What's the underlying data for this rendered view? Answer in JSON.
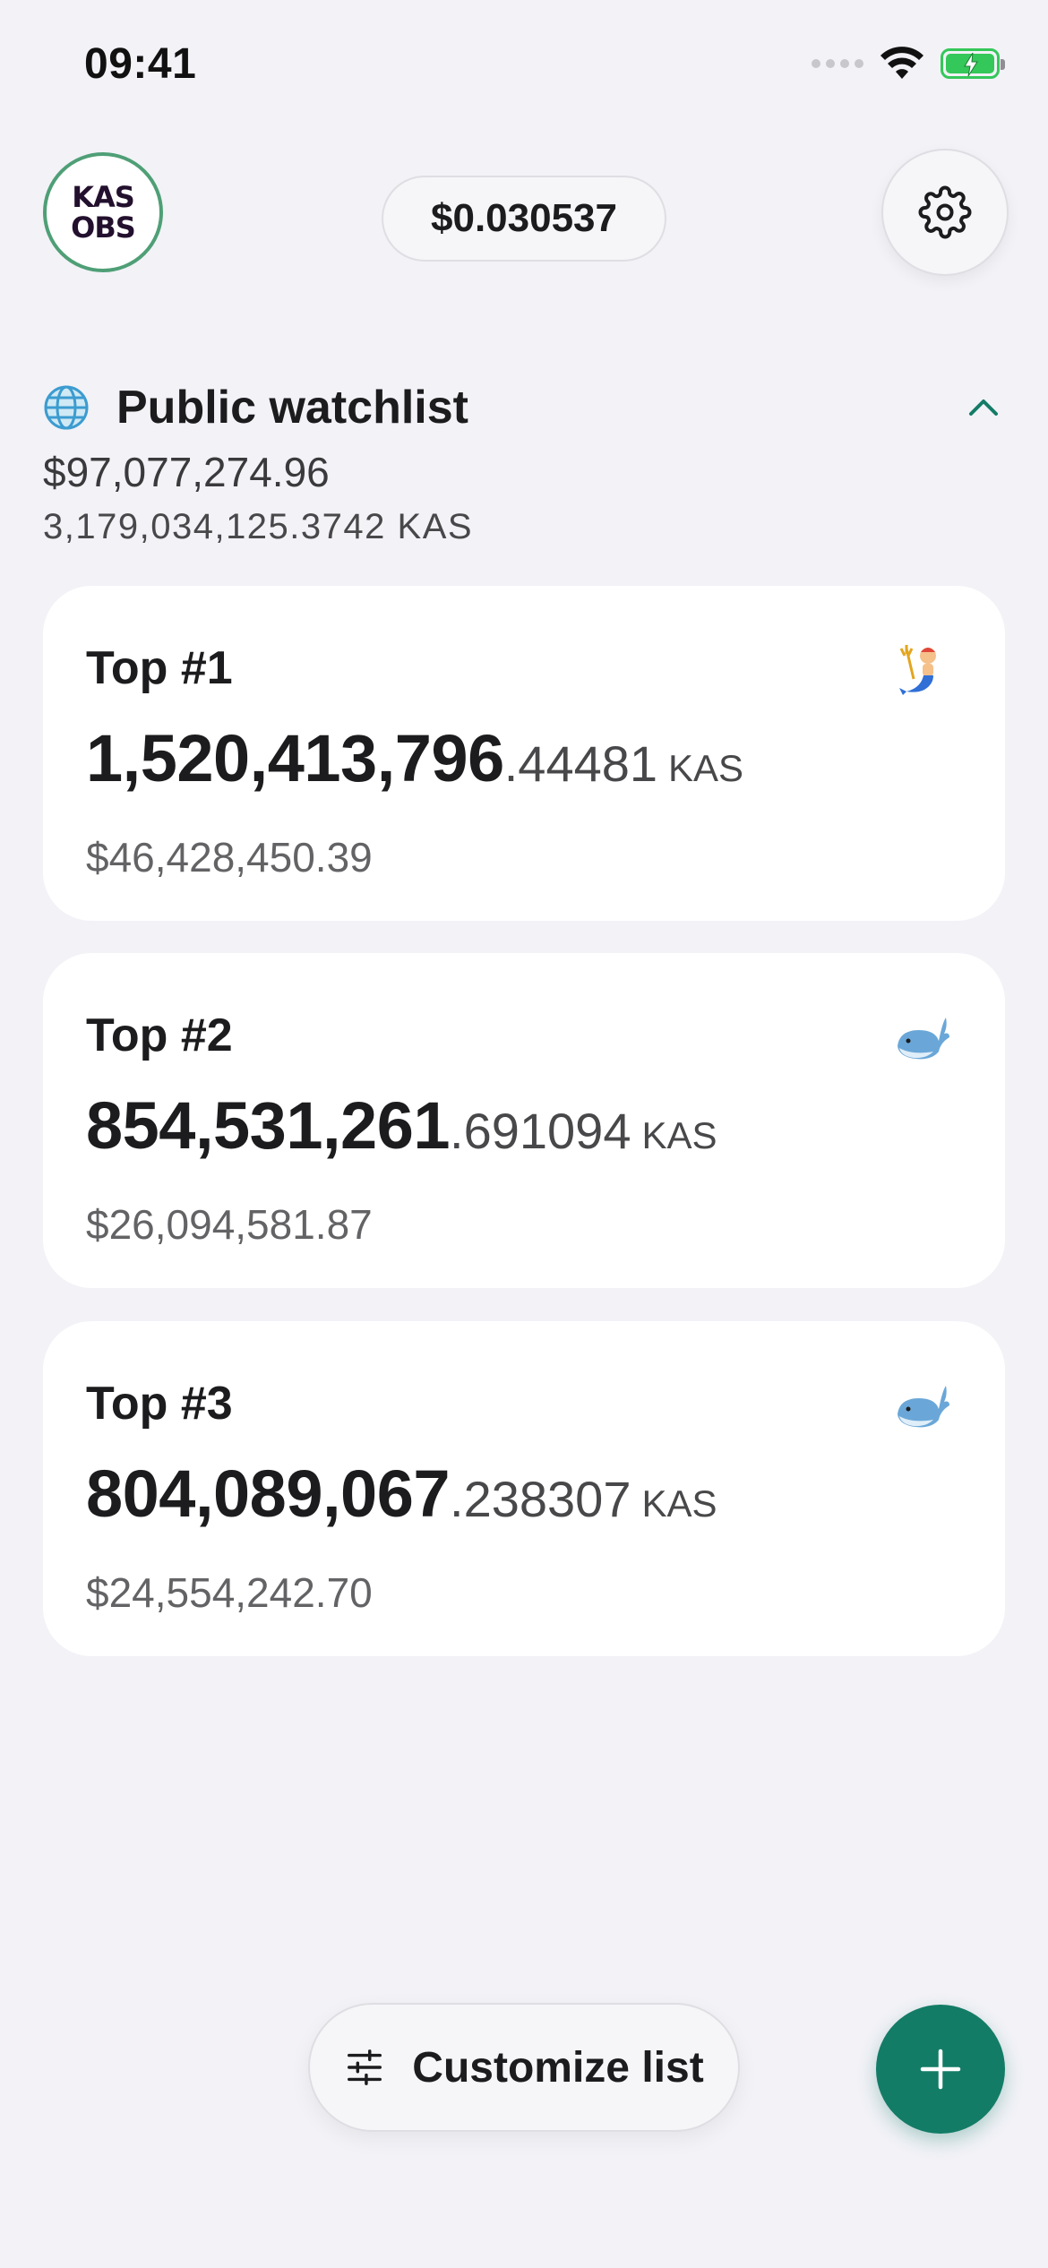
{
  "status_bar": {
    "time": "09:41",
    "icons": [
      "cellular-signal-icon",
      "wifi-icon",
      "battery-charging-icon"
    ],
    "battery_color": "#34c759"
  },
  "header": {
    "logo_line1": "KAS",
    "logo_line2": "OBS",
    "price": "$0.030537",
    "settings_icon": "gear-icon"
  },
  "watchlist": {
    "icon": "globe-icon",
    "title": "Public watchlist",
    "total_usd": "$97,077,274.96",
    "total_kas": "3,179,034,125.3742 KAS",
    "collapse_icon": "chevron-up-icon",
    "accent_color": "#137c66",
    "items": [
      {
        "label": "Top #1",
        "emoji": "merman-icon",
        "amount_int": "1,520,413,796",
        "amount_dec": ".44481",
        "unit": "KAS",
        "usd": "$46,428,450.39"
      },
      {
        "label": "Top #2",
        "emoji": "whale-icon",
        "amount_int": "854,531,261",
        "amount_dec": ".691094",
        "unit": "KAS",
        "usd": "$26,094,581.87"
      },
      {
        "label": "Top #3",
        "emoji": "whale-icon",
        "amount_int": "804,089,067",
        "amount_dec": ".238307",
        "unit": "KAS",
        "usd": "$24,554,242.70"
      }
    ]
  },
  "footer": {
    "customize_label": "Customize list",
    "customize_icon": "sliders-icon",
    "add_icon": "plus-icon",
    "add_button_color": "#137c66"
  }
}
